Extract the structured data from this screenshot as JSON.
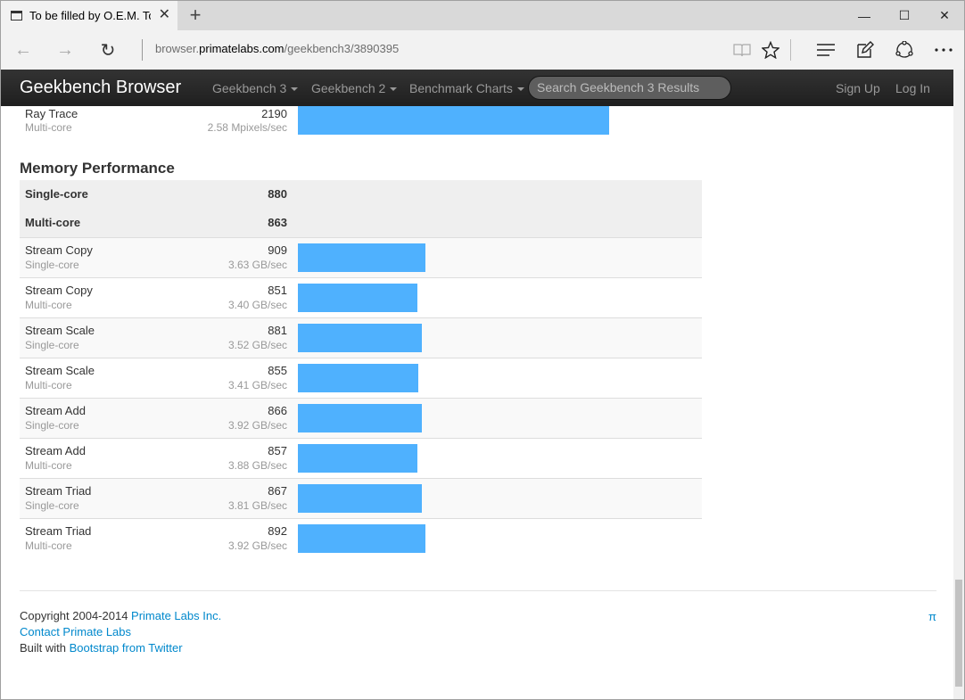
{
  "browser": {
    "tab_title": "To be filled by O.E.M. To",
    "tab_close": "✕",
    "new_tab": "+",
    "window_controls": [
      "—",
      "☐",
      "✕"
    ],
    "nav": {
      "back": "←",
      "forward": "→",
      "refresh": "↻"
    },
    "url_prefix": "browser.",
    "url_domain": "primatelabs.com",
    "url_path": "/geekbench3/3890395",
    "toolbar_icons": [
      "reading-view-icon",
      "favorite-star-icon",
      "hub-icon",
      "web-note-icon",
      "share-icon",
      "more-icon"
    ]
  },
  "site_nav": {
    "brand": "Geekbench Browser",
    "links": [
      "Geekbench 3",
      "Geekbench 2",
      "Benchmark Charts"
    ],
    "search_placeholder": "Search Geekbench 3 Results",
    "sign_up": "Sign Up",
    "log_in": "Log In"
  },
  "top_row": {
    "name": "Ray Trace",
    "mode": "Multi-core",
    "score": "2190",
    "rate": "2.58 Mpixels/sec",
    "bar_fraction": 1.0
  },
  "memory": {
    "title": "Memory Performance",
    "single_label": "Single-core",
    "single_score": "880",
    "multi_label": "Multi-core",
    "multi_score": "863",
    "rows": [
      {
        "name": "Stream Copy",
        "mode": "Single-core",
        "score": "909",
        "rate": "3.63 GB/sec",
        "bar_fraction": 0.41
      },
      {
        "name": "Stream Copy",
        "mode": "Multi-core",
        "score": "851",
        "rate": "3.40 GB/sec",
        "bar_fraction": 0.384
      },
      {
        "name": "Stream Scale",
        "mode": "Single-core",
        "score": "881",
        "rate": "3.52 GB/sec",
        "bar_fraction": 0.398
      },
      {
        "name": "Stream Scale",
        "mode": "Multi-core",
        "score": "855",
        "rate": "3.41 GB/sec",
        "bar_fraction": 0.386
      },
      {
        "name": "Stream Add",
        "mode": "Single-core",
        "score": "866",
        "rate": "3.92 GB/sec",
        "bar_fraction": 0.398
      },
      {
        "name": "Stream Add",
        "mode": "Multi-core",
        "score": "857",
        "rate": "3.88 GB/sec",
        "bar_fraction": 0.384
      },
      {
        "name": "Stream Triad",
        "mode": "Single-core",
        "score": "867",
        "rate": "3.81 GB/sec",
        "bar_fraction": 0.398
      },
      {
        "name": "Stream Triad",
        "mode": "Multi-core",
        "score": "892",
        "rate": "3.92 GB/sec",
        "bar_fraction": 0.41
      }
    ]
  },
  "footer": {
    "copyright": "Copyright 2004-2014 ",
    "company_link": "Primate Labs Inc.",
    "contact_link": "Contact Primate Labs",
    "built_with": "Built with ",
    "bootstrap_link": "Bootstrap from Twitter",
    "pi": "π"
  },
  "colors": {
    "bar": "#4fb1fe",
    "link": "#0088cc",
    "navbar": "#222222"
  }
}
